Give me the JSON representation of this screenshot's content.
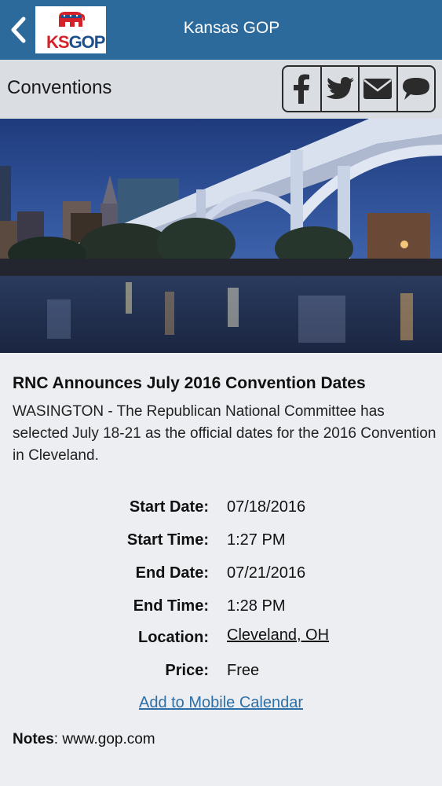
{
  "header": {
    "title": "Kansas GOP",
    "logo_ks": "KS",
    "logo_gop": "GOP",
    "back_icon": "chevron-left-icon"
  },
  "section": {
    "title": "Conventions",
    "share_icons": [
      "facebook-icon",
      "twitter-icon",
      "email-icon",
      "comment-icon"
    ]
  },
  "article": {
    "headline": "RNC Announces July 2016 Convention Dates",
    "body": "WASINGTON - The Republican National Committee has selected July 18-21 as the official dates for the 2016 Convention in Cleveland."
  },
  "details": [
    {
      "label": "Start Date:",
      "value": "07/18/2016"
    },
    {
      "label": "Start Time:",
      "value": "1:27 PM"
    },
    {
      "label": "End Date:",
      "value": "07/21/2016"
    },
    {
      "label": "End Time:",
      "value": "1:28 PM"
    },
    {
      "label": "Location:",
      "value": "Cleveland, OH"
    },
    {
      "label": "Price:",
      "value": "Free"
    }
  ],
  "add_calendar": "Add to Mobile Calendar",
  "notes": {
    "label": "Notes",
    "value": ": www.gop.com"
  },
  "colors": {
    "header": "#2d6a9c",
    "link": "#2d6fa6",
    "logo_red": "#d32229",
    "logo_blue": "#1d4f8c"
  }
}
